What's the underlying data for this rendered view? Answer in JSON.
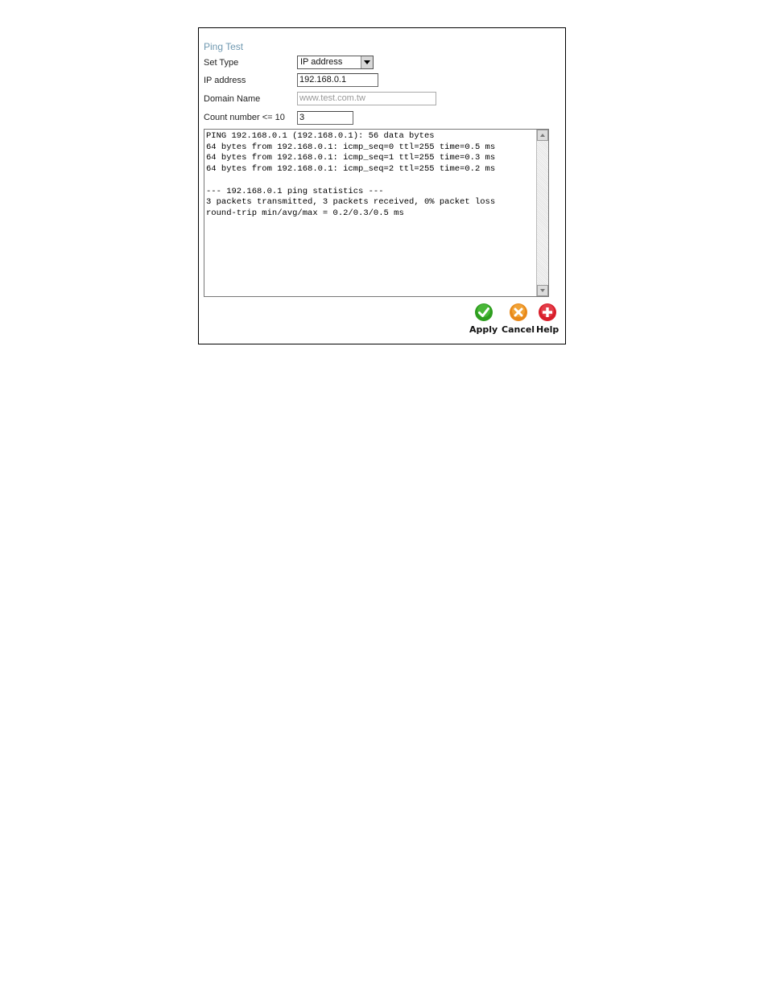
{
  "title": "Ping Test",
  "fields": {
    "set_type": {
      "label": "Set Type",
      "value": "IP address"
    },
    "ip_address": {
      "label": "IP address",
      "value": "192.168.0.1"
    },
    "domain_name": {
      "label": "Domain Name",
      "value": "www.test.com.tw"
    },
    "count": {
      "label": "Count number <= 10",
      "value": "3"
    }
  },
  "output": "PING 192.168.0.1 (192.168.0.1): 56 data bytes\n64 bytes from 192.168.0.1: icmp_seq=0 ttl=255 time=0.5 ms\n64 bytes from 192.168.0.1: icmp_seq=1 ttl=255 time=0.3 ms\n64 bytes from 192.168.0.1: icmp_seq=2 ttl=255 time=0.2 ms\n\n--- 192.168.0.1 ping statistics ---\n3 packets transmitted, 3 packets received, 0% packet loss\nround-trip min/avg/max = 0.2/0.3/0.5 ms",
  "actions": {
    "apply": {
      "label": "Apply",
      "icon": "check-icon",
      "color": "#2e9e1f"
    },
    "cancel": {
      "label": "Cancel",
      "icon": "cancel-x-icon",
      "color": "#e8891a"
    },
    "help": {
      "label": "Help",
      "icon": "plus-cross-icon",
      "color": "#d81e2a"
    }
  }
}
